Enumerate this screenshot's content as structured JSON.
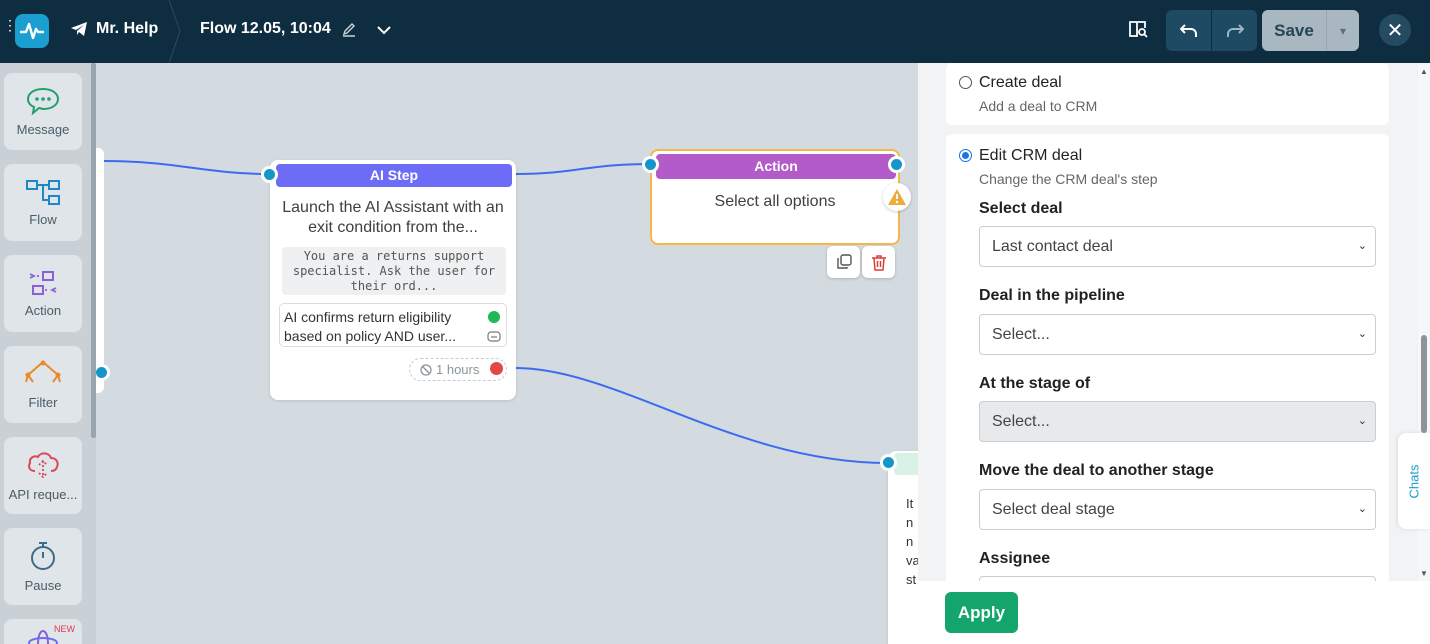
{
  "header": {
    "bot_name": "Mr. Help",
    "flow_title": "Flow 12.05, 10:04",
    "save_label": "Save",
    "colors": {
      "bar": "#0f2d40",
      "logo": "#1b9fd1"
    }
  },
  "palette": {
    "items": [
      {
        "label": "Message",
        "icon": "message-icon"
      },
      {
        "label": "Flow",
        "icon": "flow-icon"
      },
      {
        "label": "Action",
        "icon": "action-icon"
      },
      {
        "label": "Filter",
        "icon": "filter-icon"
      },
      {
        "label": "API reque...",
        "icon": "api-request-icon"
      },
      {
        "label": "Pause",
        "icon": "pause-icon"
      }
    ],
    "new_badge": "NEW"
  },
  "canvas": {
    "ai_step": {
      "title": "AI Step",
      "description": "Launch the AI Assistant with an exit condition from the...",
      "prompt": "You are a returns support specialist. Ask the user for their ord...",
      "exit_condition": "AI confirms return eligibility based on policy AND user...",
      "timeout": "1 hours"
    },
    "action": {
      "title": "Action",
      "body": "Select all options"
    },
    "partial_node_lines": [
      "It",
      "n",
      "n",
      "va",
      "st"
    ]
  },
  "panel": {
    "options": [
      {
        "title": "Create deal",
        "subtitle": "Add a deal to CRM",
        "selected": false
      },
      {
        "title": "Edit CRM deal",
        "subtitle": "Change the CRM deal's step",
        "selected": true
      }
    ],
    "fields": [
      {
        "label": "Select deal",
        "value": "Last contact deal",
        "disabled": false
      },
      {
        "label": "Deal in the pipeline",
        "value": "Select...",
        "disabled": false
      },
      {
        "label": "At the stage of",
        "value": "Select...",
        "disabled": true
      },
      {
        "label": "Move the deal to another stage",
        "value": "Select deal stage",
        "disabled": false
      },
      {
        "label": "Assignee",
        "value": "",
        "disabled": false
      }
    ],
    "chats_tab": "Chats",
    "apply_label": "Apply",
    "colors": {
      "apply": "#14a56c",
      "radio": "#1a73e8"
    }
  }
}
